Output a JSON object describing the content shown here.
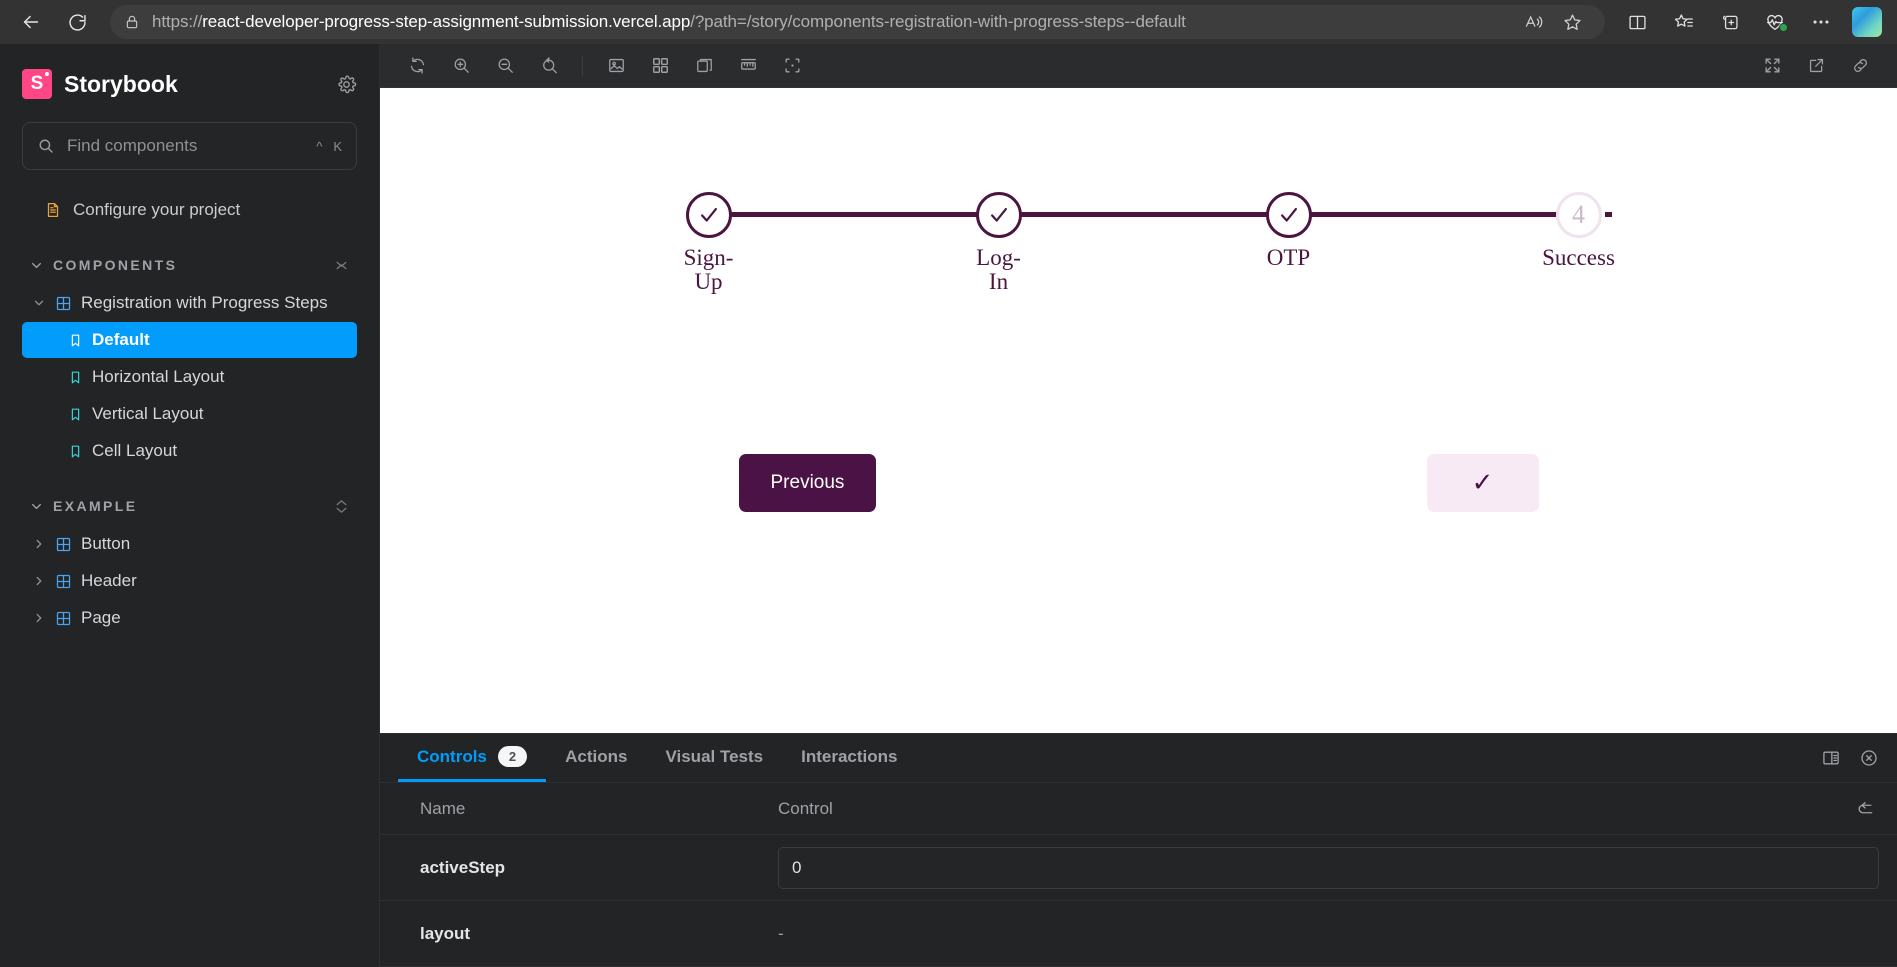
{
  "browser": {
    "back_label": "Back",
    "reload_label": "Refresh",
    "lock_label": "site-information",
    "url_prefix": "https://",
    "url_host": "react-developer-progress-step-assignment-submission.vercel.app",
    "url_path": "/?path=/story/components-registration-with-progress-steps--default",
    "read_aloud_label": "Read aloud",
    "favorite_label": "Add this page to favorites",
    "split_screen_label": "Split screen",
    "favorites_label": "Favorites",
    "collections_label": "Collections",
    "essentials_label": "Browser essentials",
    "settings_label": "Settings and more",
    "copilot_label": "Copilot"
  },
  "sidebar": {
    "brand": "Storybook",
    "logo_letter": "S",
    "settings_label": "Settings",
    "search": {
      "placeholder": "Find components",
      "value": "",
      "shortcut_modifier": "^",
      "shortcut_key": "K"
    },
    "configure": {
      "label": "Configure your project"
    },
    "groups": [
      {
        "label": "COMPONENTS",
        "items": [
          {
            "label": "Registration with Progress Steps",
            "type": "component",
            "expanded": true,
            "children": [
              {
                "label": "Default",
                "type": "story",
                "selected": true
              },
              {
                "label": "Horizontal Layout",
                "type": "story",
                "selected": false
              },
              {
                "label": "Vertical Layout",
                "type": "story",
                "selected": false
              },
              {
                "label": "Cell Layout",
                "type": "story",
                "selected": false
              }
            ]
          }
        ]
      },
      {
        "label": "EXAMPLE",
        "items": [
          {
            "label": "Button",
            "type": "component",
            "expanded": false,
            "children": []
          },
          {
            "label": "Header",
            "type": "component",
            "expanded": false,
            "children": []
          },
          {
            "label": "Page",
            "type": "component",
            "expanded": false,
            "children": []
          }
        ]
      }
    ]
  },
  "canvas_toolbar": {
    "remount_label": "Remount component",
    "zoom_in_label": "Zoom in",
    "zoom_out_label": "Zoom out",
    "zoom_reset_label": "Reset zoom",
    "backgrounds_label": "Change background",
    "grid_label": "Apply a grid to the preview",
    "theme_label": "Change theme",
    "measure_label": "Enable measure",
    "outline_label": "Apply outlines to the preview",
    "fullscreen_label": "Go full screen",
    "open_new_tab_label": "Open canvas in new tab",
    "copy_link_label": "Copy canvas link"
  },
  "story": {
    "accent_dark": "#4b1540",
    "accent_light": "#f7eaf5",
    "steps": [
      {
        "index": 1,
        "label": "Sign-Up",
        "state": "completed",
        "marker": "check"
      },
      {
        "index": 2,
        "label": "Log-In",
        "state": "completed",
        "marker": "check"
      },
      {
        "index": 3,
        "label": "OTP",
        "state": "completed",
        "marker": "check"
      },
      {
        "index": 4,
        "label": "Success",
        "state": "pending",
        "marker": "4"
      }
    ],
    "prev_button": "Previous",
    "next_button": "✓"
  },
  "panel": {
    "tabs": [
      {
        "label": "Controls",
        "badge": "2",
        "active": true
      },
      {
        "label": "Actions",
        "badge": "",
        "active": false
      },
      {
        "label": "Visual Tests",
        "badge": "",
        "active": false
      },
      {
        "label": "Interactions",
        "badge": "",
        "active": false
      }
    ],
    "position_label": "Change addon orientation",
    "close_label": "Hide addons",
    "reset_label": "Reset controls",
    "columns": {
      "name": "Name",
      "control": "Control"
    },
    "rows": [
      {
        "name": "activeStep",
        "control_type": "number",
        "value": "0"
      },
      {
        "name": "layout",
        "control_type": "none",
        "value": "-"
      }
    ]
  }
}
